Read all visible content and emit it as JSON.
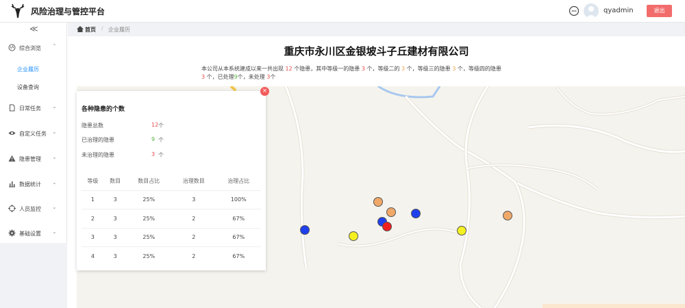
{
  "header": {
    "app_title": "风险治理与管控平台",
    "username": "qyadmin",
    "logout_label": "退出"
  },
  "sidebar": {
    "collapse_glyph": "≪",
    "items": [
      {
        "label": "综合浏览",
        "icon": "globe-icon",
        "chevron": "⌃"
      },
      {
        "label": "日常任务",
        "icon": "file-icon",
        "chevron": "⌄"
      },
      {
        "label": "自定义任务",
        "icon": "eye-icon",
        "chevron": "⌄"
      },
      {
        "label": "隐患管理",
        "icon": "warning-icon",
        "chevron": "⌄"
      },
      {
        "label": "数据统计",
        "icon": "bar-chart-icon",
        "chevron": "⌄"
      },
      {
        "label": "人员监控",
        "icon": "crosshair-icon",
        "chevron": "⌄"
      },
      {
        "label": "基础设置",
        "icon": "gear-icon",
        "chevron": "⌄"
      }
    ],
    "sub_items": [
      {
        "label": "企业履历",
        "active": true
      },
      {
        "label": "设备查询",
        "active": false
      }
    ]
  },
  "breadcrumb": {
    "home": "首页",
    "separator": "/",
    "current": "企业履历"
  },
  "company": {
    "title": "重庆市永川区金银坡斗子丘建材有限公司",
    "summary": {
      "p1": "本公司从本系统建成以来一共出现",
      "total": "12",
      "p2": "个隐患，其中等级一的隐患",
      "l1": "3",
      "p3": "个，等级二的",
      "l2": "3",
      "p4": "个，等级三的隐患",
      "l3": "3",
      "p5": "个，等级四的隐患",
      "l4": "3",
      "p6": "个，已处理",
      "handled": "9",
      "p7": "个，未处理",
      "unhandled": "3",
      "p8": "个"
    }
  },
  "panel": {
    "close_glyph": "×",
    "title": "各种隐患的个数",
    "stats": [
      {
        "label": "隐患总数",
        "value": "12",
        "unit": "个",
        "color": "#e84b4b"
      },
      {
        "label": "已治理的隐患",
        "value": "9",
        "unit": "个",
        "color": "#52b43a"
      },
      {
        "label": "未治理的隐患",
        "value": "3",
        "unit": "个",
        "color": "#e84b4b"
      }
    ],
    "table": {
      "headers": [
        "等级",
        "数目",
        "数目占比",
        "治理数目",
        "治理占比"
      ],
      "rows": [
        [
          "1",
          "3",
          "25%",
          "3",
          "100%"
        ],
        [
          "2",
          "3",
          "25%",
          "2",
          "67%"
        ],
        [
          "3",
          "3",
          "25%",
          "2",
          "67%"
        ],
        [
          "4",
          "3",
          "25%",
          "2",
          "67%"
        ]
      ]
    }
  },
  "map": {
    "markers": [
      {
        "color": "#f0a868"
      },
      {
        "color": "#f0a868"
      },
      {
        "color": "#2040ee"
      },
      {
        "color": "#2040ee"
      },
      {
        "color": "#ee2020"
      },
      {
        "color": "#2040ee"
      },
      {
        "color": "#f5f020"
      },
      {
        "color": "#f5f020"
      },
      {
        "color": "#f0a868"
      }
    ]
  }
}
